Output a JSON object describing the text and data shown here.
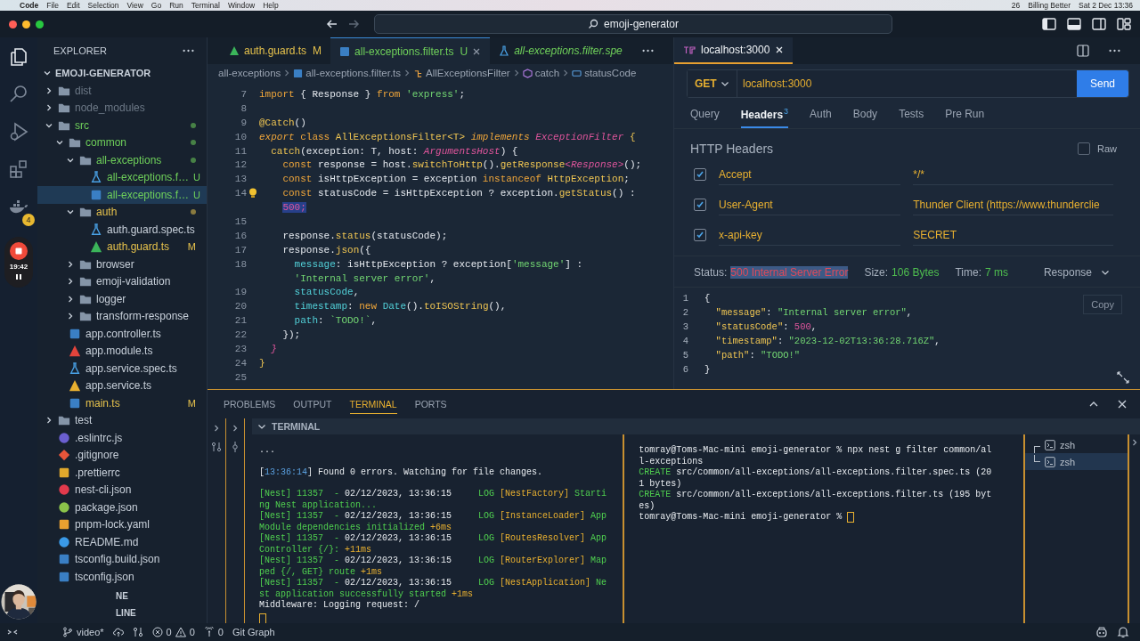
{
  "menubar": {
    "items": [
      "Code",
      "File",
      "Edit",
      "Selection",
      "View",
      "Go",
      "Run",
      "Terminal",
      "Window",
      "Help"
    ],
    "extras": [
      "26",
      "Billing Better",
      "Sat 2 Dec 13:36"
    ]
  },
  "titlebar": {
    "search": "emoji-generator"
  },
  "activity": {
    "badge": "4",
    "recorder_time": "19:42"
  },
  "explorer": {
    "title": "EXPLORER",
    "root": "EMOJI-GENERATOR",
    "items": [
      {
        "name": "dist",
        "kind": "folder",
        "color": "#6c7886",
        "expanded": false,
        "selected": false
      },
      {
        "name": "node_modules",
        "kind": "folder",
        "color": "#6c7886",
        "expanded": false,
        "selected": false
      },
      {
        "name": "src",
        "kind": "folder",
        "color": "#6fd05a",
        "dot": true,
        "expanded": true,
        "selected": false,
        "children": [
          {
            "name": "common",
            "kind": "folder",
            "color": "#6fd05a",
            "dot": true,
            "expanded": true,
            "selected": false,
            "children": [
              {
                "name": "all-exceptions",
                "kind": "folder",
                "color": "#6fd05a",
                "dot": true,
                "expanded": true,
                "selected": false,
                "children": [
                  {
                    "name": "all-exceptions.f…",
                    "kind": "spec",
                    "color": "#6fd05a",
                    "status": "U",
                    "selected": false
                  },
                  {
                    "name": "all-exceptions.f…",
                    "kind": "ts",
                    "color": "#6fd05a",
                    "status": "U",
                    "selected": true
                  }
                ]
              },
              {
                "name": "auth",
                "kind": "folder",
                "color": "#e6c24c",
                "dot": true,
                "expanded": true,
                "selected": false,
                "children": [
                  {
                    "name": "auth.guard.spec.ts",
                    "kind": "spec",
                    "color": "#c8d0da",
                    "selected": false
                  },
                  {
                    "name": "auth.guard.ts",
                    "kind": "angular",
                    "color": "#e6c24c",
                    "status": "M",
                    "selected": false
                  }
                ]
              },
              {
                "name": "browser",
                "kind": "folder",
                "color": "#c8d0da",
                "expanded": false,
                "selected": false
              },
              {
                "name": "emoji-validation",
                "kind": "folder",
                "color": "#c8d0da",
                "expanded": false,
                "selected": false
              },
              {
                "name": "logger",
                "kind": "folder",
                "color": "#c8d0da",
                "expanded": false,
                "selected": false
              },
              {
                "name": "transform-response",
                "kind": "folder",
                "color": "#c8d0da",
                "expanded": false,
                "selected": false
              }
            ]
          },
          {
            "name": "app.controller.ts",
            "kind": "ts",
            "color": "#c8d0da",
            "selected": false
          },
          {
            "name": "app.module.ts",
            "kind": "module",
            "color": "#c8d0da",
            "selected": false
          },
          {
            "name": "app.service.spec.ts",
            "kind": "spec",
            "color": "#c8d0da",
            "selected": false
          },
          {
            "name": "app.service.ts",
            "kind": "service",
            "color": "#c8d0da",
            "selected": false
          },
          {
            "name": "main.ts",
            "kind": "ts",
            "color": "#e6c24c",
            "status": "M",
            "selected": false
          }
        ]
      },
      {
        "name": "test",
        "kind": "folder",
        "color": "#c8d0da",
        "expanded": false,
        "selected": false
      },
      {
        "name": ".eslintrc.js",
        "kind": "eslint",
        "color": "#c8d0da",
        "selected": false
      },
      {
        "name": ".gitignore",
        "kind": "git",
        "color": "#c8d0da",
        "selected": false
      },
      {
        "name": ".prettierrc",
        "kind": "prettier",
        "color": "#c8d0da",
        "selected": false
      },
      {
        "name": "nest-cli.json",
        "kind": "nest",
        "color": "#c8d0da",
        "selected": false
      },
      {
        "name": "package.json",
        "kind": "js",
        "color": "#c8d0da",
        "selected": false
      },
      {
        "name": "pnpm-lock.yaml",
        "kind": "yaml",
        "color": "#c8d0da",
        "selected": false
      },
      {
        "name": "README.md",
        "kind": "info",
        "color": "#c8d0da",
        "selected": false
      },
      {
        "name": "tsconfig.build.json",
        "kind": "ts",
        "color": "#c8d0da",
        "selected": false
      },
      {
        "name": "tsconfig.json",
        "kind": "ts",
        "color": "#c8d0da",
        "selected": false
      }
    ],
    "sections": [
      "NE",
      "LINE"
    ]
  },
  "editor": {
    "tabs": [
      {
        "label": "auth.guard.ts",
        "status": "M",
        "color": "#e6c24c",
        "preview": false,
        "selected": false
      },
      {
        "label": "all-exceptions.filter.ts",
        "status": "U",
        "color": "#6fd05a",
        "preview": false,
        "selected": true
      },
      {
        "label": "all-exceptions.filter.spe",
        "color": "#6fd05a",
        "preview": true,
        "selected": false
      }
    ],
    "breadcrumb": [
      {
        "text": "all-exceptions",
        "kind": "folder"
      },
      {
        "text": "all-exceptions.filter.ts",
        "kind": "file"
      },
      {
        "text": "AllExceptionsFilter",
        "kind": "class"
      },
      {
        "text": "catch",
        "kind": "method"
      },
      {
        "text": "statusCode",
        "kind": "variable"
      }
    ],
    "lines": [
      {
        "n": "7",
        "tokens": [
          {
            "text": "import",
            "kind": "kw"
          },
          {
            "text": " { Response } ",
            "kind": "plain"
          },
          {
            "text": "from",
            "kind": "kw"
          },
          {
            "text": " 'express'",
            "kind": "str"
          },
          {
            "text": ";",
            "kind": "plain"
          }
        ]
      },
      {
        "n": "8"
      },
      {
        "n": "9",
        "tokens": [
          {
            "text": "@Catch",
            "kind": "fn"
          },
          {
            "text": "()",
            "kind": "plain"
          }
        ]
      },
      {
        "n": "10",
        "tokens": [
          {
            "text": "export",
            "kind": "kwi"
          },
          {
            "text": " class",
            "kind": "kw"
          },
          {
            "text": " AllExceptionsFilter<T>",
            "kind": "cls"
          },
          {
            "text": " implements",
            "kind": "kwi"
          },
          {
            "text": " ExceptionFilter",
            "kind": "type"
          },
          {
            "text": " {",
            "kind": "fn"
          }
        ]
      },
      {
        "n": "11",
        "tokens": [
          {
            "text": "  catch",
            "kind": "fn"
          },
          {
            "text": "(exception: T, host: ",
            "kind": "plain"
          },
          {
            "text": "ArgumentsHost",
            "kind": "type"
          },
          {
            "text": ") {",
            "kind": "plain"
          }
        ]
      },
      {
        "n": "12",
        "tokens": [
          {
            "text": "    const",
            "kind": "kw"
          },
          {
            "text": " response = host.",
            "kind": "plain"
          },
          {
            "text": "switchToHttp",
            "kind": "fn"
          },
          {
            "text": "().",
            "kind": "plain"
          },
          {
            "text": "getResponse",
            "kind": "fn"
          },
          {
            "text": "<Response>",
            "kind": "type"
          },
          {
            "text": "();",
            "kind": "plain"
          }
        ]
      },
      {
        "n": "13",
        "tokens": [
          {
            "text": "    const",
            "kind": "kw"
          },
          {
            "text": " isHttpException = exception ",
            "kind": "plain"
          },
          {
            "text": "instanceof",
            "kind": "kw"
          },
          {
            "text": " HttpException",
            "kind": "cls"
          },
          {
            "text": ";",
            "kind": "plain"
          }
        ]
      },
      {
        "n": "14",
        "bulb": true,
        "tokens": [
          {
            "text": "    const",
            "kind": "kw"
          },
          {
            "text": " statusCode = isHttpException ? exception.",
            "kind": "plain"
          },
          {
            "text": "getStatus",
            "kind": "fn"
          },
          {
            "text": "() :",
            "kind": "plain"
          }
        ]
      },
      {
        "tokens": [
          {
            "text": "    500;",
            "kind": "num"
          }
        ]
      },
      {
        "n": "15"
      },
      {
        "n": "16",
        "tokens": [
          {
            "text": "    response.",
            "kind": "plain"
          },
          {
            "text": "status",
            "kind": "fn"
          },
          {
            "text": "(statusCode);",
            "kind": "plain"
          }
        ]
      },
      {
        "n": "17",
        "tokens": [
          {
            "text": "    response.",
            "kind": "plain"
          },
          {
            "text": "json",
            "kind": "fn"
          },
          {
            "text": "({",
            "kind": "plain"
          }
        ]
      },
      {
        "n": "18",
        "tokens": [
          {
            "text": "      message",
            "kind": "prop"
          },
          {
            "text": ": isHttpException ? exception[",
            "kind": "plain"
          },
          {
            "text": "'message'",
            "kind": "str"
          },
          {
            "text": "] :",
            "kind": "plain"
          }
        ]
      },
      {
        "tokens": [
          {
            "text": "      'Internal server error'",
            "kind": "str"
          },
          {
            "text": ",",
            "kind": "plain"
          }
        ]
      },
      {
        "n": "19",
        "tokens": [
          {
            "text": "      statusCode",
            "kind": "prop"
          },
          {
            "text": ",",
            "kind": "plain"
          }
        ]
      },
      {
        "n": "20",
        "tokens": [
          {
            "text": "      timestamp",
            "kind": "prop"
          },
          {
            "text": ": ",
            "kind": "plain"
          },
          {
            "text": "new",
            "kind": "kw"
          },
          {
            "text": " Date",
            "kind": "prop"
          },
          {
            "text": "().",
            "kind": "plain"
          },
          {
            "text": "toISOString",
            "kind": "fn"
          },
          {
            "text": "(),",
            "kind": "plain"
          }
        ]
      },
      {
        "n": "21",
        "tokens": [
          {
            "text": "      path",
            "kind": "prop"
          },
          {
            "text": ": ",
            "kind": "plain"
          },
          {
            "text": "`TODO!`",
            "kind": "str"
          },
          {
            "text": ",",
            "kind": "plain"
          }
        ]
      },
      {
        "n": "22",
        "tokens": [
          {
            "text": "    });",
            "kind": "plain"
          }
        ]
      },
      {
        "n": "23",
        "tokens": [
          {
            "text": "  }",
            "kind": "type"
          }
        ]
      },
      {
        "n": "24",
        "tokens": [
          {
            "text": "}",
            "kind": "fn"
          }
        ]
      },
      {
        "n": "25"
      }
    ]
  },
  "thunder": {
    "tab": "localhost:3000",
    "method": "GET",
    "url": "localhost:3000",
    "send": "Send",
    "tabs": [
      {
        "label": "Query",
        "selected": false
      },
      {
        "label": "Headers",
        "badge": "3",
        "selected": true
      },
      {
        "label": "Auth",
        "selected": false
      },
      {
        "label": "Body",
        "selected": false
      },
      {
        "label": "Tests",
        "selected": false
      },
      {
        "label": "Pre Run",
        "selected": false
      }
    ],
    "headers_title": "HTTP Headers",
    "raw": {
      "label": "Raw",
      "checked": false
    },
    "headers": [
      {
        "checked": true,
        "key": "Accept",
        "value": "*/*"
      },
      {
        "checked": true,
        "key": "User-Agent",
        "value": "Thunder Client (https://www.thunderclie"
      },
      {
        "checked": true,
        "key": "x-api-key",
        "value": "SECRET"
      }
    ],
    "status": {
      "label": "Status:",
      "value": "500 Internal Server Error",
      "highlighted": true
    },
    "size": {
      "label": "Size:",
      "value": "106 Bytes"
    },
    "time": {
      "label": "Time:",
      "value": "7 ms"
    },
    "view": "Response",
    "copy": "Copy",
    "response": [
      {
        "n": "1",
        "tokens": [
          {
            "text": "{",
            "kind": "plain"
          }
        ]
      },
      {
        "n": "2",
        "tokens": [
          {
            "text": "  \"message\"",
            "kind": "fn"
          },
          {
            "text": ": ",
            "kind": "plain"
          },
          {
            "text": "\"Internal server error\"",
            "kind": "str"
          },
          {
            "text": ",",
            "kind": "plain"
          }
        ]
      },
      {
        "n": "3",
        "tokens": [
          {
            "text": "  \"statusCode\"",
            "kind": "fn"
          },
          {
            "text": ": ",
            "kind": "plain"
          },
          {
            "text": "500",
            "kind": "pink"
          },
          {
            "text": ",",
            "kind": "plain"
          }
        ]
      },
      {
        "n": "4",
        "tokens": [
          {
            "text": "  \"timestamp\"",
            "kind": "fn"
          },
          {
            "text": ": ",
            "kind": "plain"
          },
          {
            "text": "\"2023-12-02T13:36:28.716Z\"",
            "kind": "str"
          },
          {
            "text": ",",
            "kind": "plain"
          }
        ]
      },
      {
        "n": "5",
        "tokens": [
          {
            "text": "  \"path\"",
            "kind": "fn"
          },
          {
            "text": ": ",
            "kind": "plain"
          },
          {
            "text": "\"TODO!\"",
            "kind": "str"
          }
        ]
      },
      {
        "n": "6",
        "tokens": [
          {
            "text": "}",
            "kind": "plain"
          }
        ]
      }
    ]
  },
  "panel": {
    "tabs": [
      {
        "label": "PROBLEMS",
        "selected": false
      },
      {
        "label": "OUTPUT",
        "selected": false
      },
      {
        "label": "TERMINAL",
        "selected": true
      },
      {
        "label": "PORTS",
        "selected": false
      }
    ],
    "terminal_title": "TERMINAL",
    "left_blocks": [
      [
        {
          "segments": [
            {
              "text": "...",
              "kind": "plain"
            }
          ]
        }
      ],
      [
        {
          "segments": [
            {
              "text": "[",
              "kind": "plain"
            },
            {
              "text": "13:36:14",
              "kind": "blue"
            },
            {
              "text": "] Found 0 errors. Watching for file changes.",
              "kind": "plain"
            }
          ]
        }
      ],
      [
        {
          "segments": [
            {
              "text": "[Nest] 11357  - ",
              "kind": "green"
            },
            {
              "text": "02/12/2023, 13:36:15     ",
              "kind": "plain"
            },
            {
              "text": "LOG ",
              "kind": "green"
            },
            {
              "text": "[NestFactory] ",
              "kind": "yellow"
            },
            {
              "text": "Starti",
              "kind": "green"
            }
          ]
        },
        {
          "segments": [
            {
              "text": "ng Nest application...",
              "kind": "green"
            }
          ]
        },
        {
          "segments": [
            {
              "text": "[Nest] 11357  - ",
              "kind": "green"
            },
            {
              "text": "02/12/2023, 13:36:15     ",
              "kind": "plain"
            },
            {
              "text": "LOG ",
              "kind": "green"
            },
            {
              "text": "[InstanceLoader] ",
              "kind": "yellow"
            },
            {
              "text": "App",
              "kind": "green"
            }
          ]
        },
        {
          "segments": [
            {
              "text": "Module dependencies initialized ",
              "kind": "green"
            },
            {
              "text": "+6ms",
              "kind": "yellow"
            }
          ]
        },
        {
          "segments": [
            {
              "text": "[Nest] 11357  - ",
              "kind": "green"
            },
            {
              "text": "02/12/2023, 13:36:15     ",
              "kind": "plain"
            },
            {
              "text": "LOG ",
              "kind": "green"
            },
            {
              "text": "[RoutesResolver] ",
              "kind": "yellow"
            },
            {
              "text": "App",
              "kind": "green"
            }
          ]
        },
        {
          "segments": [
            {
              "text": "Controller {/}: ",
              "kind": "green"
            },
            {
              "text": "+11ms",
              "kind": "yellow"
            }
          ]
        },
        {
          "segments": [
            {
              "text": "[Nest] 11357  - ",
              "kind": "green"
            },
            {
              "text": "02/12/2023, 13:36:15     ",
              "kind": "plain"
            },
            {
              "text": "LOG ",
              "kind": "green"
            },
            {
              "text": "[RouterExplorer] ",
              "kind": "yellow"
            },
            {
              "text": "Map",
              "kind": "green"
            }
          ]
        },
        {
          "segments": [
            {
              "text": "ped {/, GET} route ",
              "kind": "green"
            },
            {
              "text": "+1ms",
              "kind": "yellow"
            }
          ]
        },
        {
          "segments": [
            {
              "text": "[Nest] 11357  - ",
              "kind": "green"
            },
            {
              "text": "02/12/2023, 13:36:15     ",
              "kind": "plain"
            },
            {
              "text": "LOG ",
              "kind": "green"
            },
            {
              "text": "[NestApplication] ",
              "kind": "yellow"
            },
            {
              "text": "Ne",
              "kind": "green"
            }
          ]
        },
        {
          "segments": [
            {
              "text": "st application successfully started ",
              "kind": "green"
            },
            {
              "text": "+1ms",
              "kind": "yellow"
            }
          ]
        },
        {
          "segments": [
            {
              "text": "Middleware: Logging request: /",
              "kind": "plain"
            }
          ]
        }
      ]
    ],
    "right_lines": [
      {
        "segments": [
          {
            "text": "tomray@Toms-Mac-mini emoji-generator % npx nest g filter common/al",
            "kind": "plain"
          }
        ]
      },
      {
        "segments": [
          {
            "text": "l-exceptions",
            "kind": "plain"
          }
        ]
      },
      {
        "segments": [
          {
            "text": "CREATE ",
            "kind": "green"
          },
          {
            "text": "src/common/all-exceptions/all-exceptions.filter.spec.ts (20",
            "kind": "plain"
          }
        ]
      },
      {
        "segments": [
          {
            "text": "1 bytes)",
            "kind": "plain"
          }
        ]
      },
      {
        "segments": [
          {
            "text": "CREATE ",
            "kind": "green"
          },
          {
            "text": "src/common/all-exceptions/all-exceptions.filter.ts (195 byt",
            "kind": "plain"
          }
        ]
      },
      {
        "segments": [
          {
            "text": "es)",
            "kind": "plain"
          }
        ]
      },
      {
        "segments": [
          {
            "text": "tomray@Toms-Mac-mini emoji-generator %",
            "kind": "plain"
          }
        ]
      }
    ],
    "sessions": [
      {
        "label": "zsh",
        "selected": false
      },
      {
        "label": "zsh",
        "selected": true
      }
    ]
  },
  "status_bar": {
    "branch": "video*",
    "errors": "0",
    "warnings": "0",
    "ports": "0",
    "git_graph": "Git Graph"
  }
}
